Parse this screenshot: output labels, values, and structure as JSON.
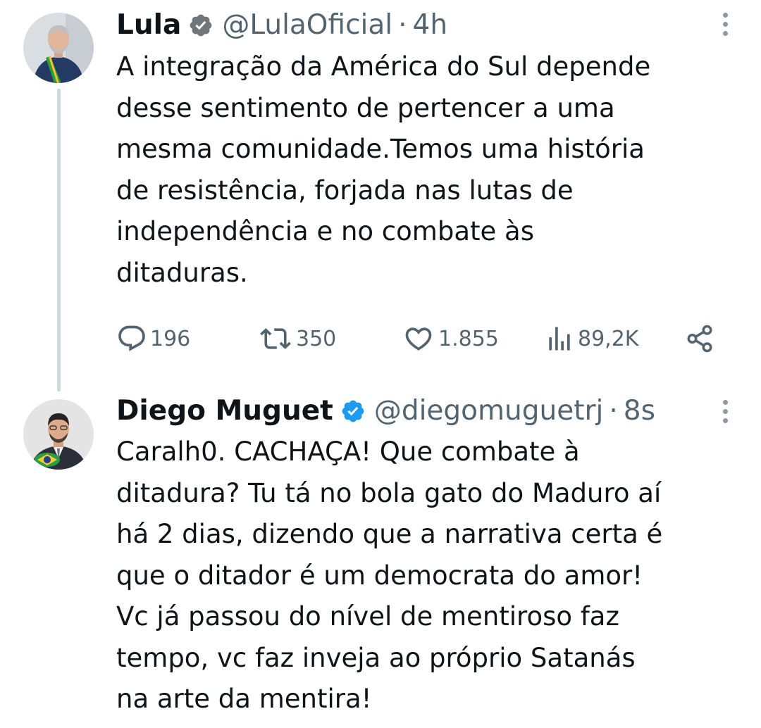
{
  "thread": [
    {
      "display_name": "Lula",
      "handle": "@LulaOficial",
      "separator": "·",
      "time": "4h",
      "text": "A integração da América do Sul depende\ndesse sentimento de pertencer a uma\nmesma comunidade.Temos uma história\nde resistência, forjada nas lutas de\nindependência e no combate às\nditaduras.",
      "verified": true,
      "stats": {
        "replies": "196",
        "reposts": "350",
        "likes": "1.855",
        "views": "89,2K"
      }
    },
    {
      "display_name": "Diego Muguet",
      "handle": "@diegomuguetrj",
      "separator": "·",
      "time": "8s",
      "text": "Caralh0. CACHAÇA! Que combate à\nditadura? Tu tá no bola gato do Maduro aí\nhá 2 dias, dizendo que a narrativa certa é\nque o ditador é um democrata do amor!\nVc já passou do nível de mentiroso faz\ntempo, vc faz inveja ao próprio Satanás\nna arte da mentira!",
      "verified": true
    }
  ],
  "icons": {
    "reply": "reply-icon",
    "repost": "repost-icon",
    "like": "heart-icon",
    "views": "views-icon",
    "share": "share-icon",
    "verified": "verified-badge-icon",
    "more": "more-options-icon"
  },
  "colors": {
    "text": "#0f1419",
    "secondary": "#536471",
    "verified": "#1d9bf0",
    "thread_line": "#cfd9de"
  }
}
